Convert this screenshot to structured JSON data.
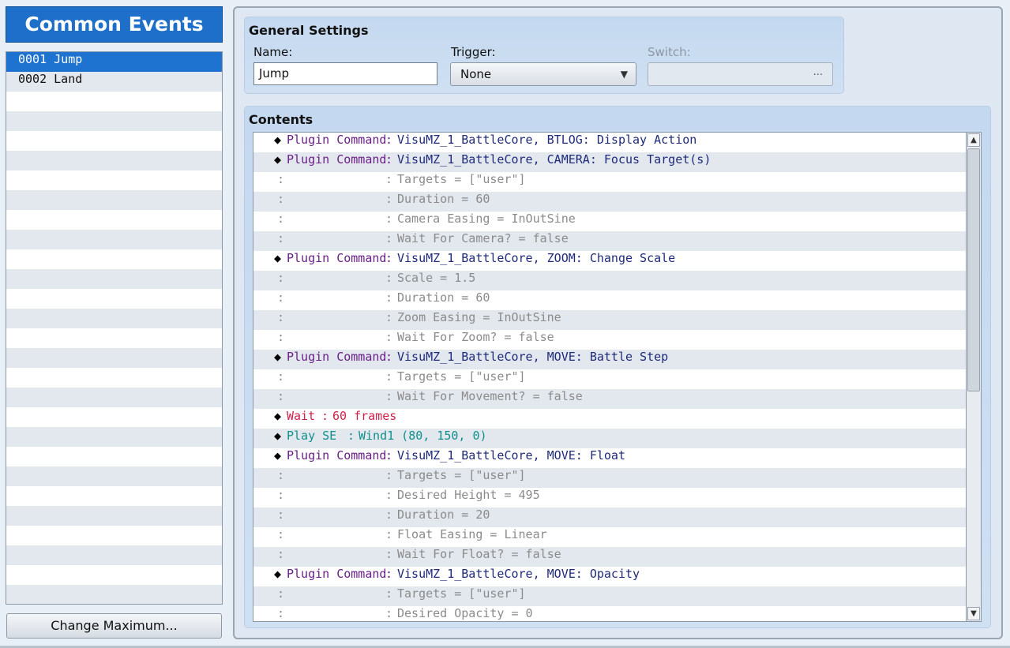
{
  "sidebar": {
    "title": "Common Events",
    "items": [
      {
        "id": "0001",
        "label": "Jump"
      },
      {
        "id": "0002",
        "label": "Land"
      }
    ],
    "change_max_label": "Change Maximum..."
  },
  "general": {
    "title": "General Settings",
    "name_label": "Name:",
    "name_value": "Jump",
    "trigger_label": "Trigger:",
    "trigger_value": "None",
    "switch_label": "Switch:",
    "switch_value": "",
    "switch_button": "..."
  },
  "contents": {
    "title": "Contents",
    "commands": [
      {
        "type": "plugin",
        "name": "Plugin Command",
        "text": "VisuMZ_1_BattleCore, BTLOG: Display Action"
      },
      {
        "type": "plugin",
        "name": "Plugin Command",
        "text": "VisuMZ_1_BattleCore, CAMERA: Focus Target(s)"
      },
      {
        "type": "cont",
        "text": "Targets = [\"user\"]"
      },
      {
        "type": "cont",
        "text": "Duration = 60"
      },
      {
        "type": "cont",
        "text": "Camera Easing = InOutSine"
      },
      {
        "type": "cont",
        "text": "Wait For Camera? = false"
      },
      {
        "type": "plugin",
        "name": "Plugin Command",
        "text": "VisuMZ_1_BattleCore, ZOOM: Change Scale"
      },
      {
        "type": "cont",
        "text": "Scale = 1.5"
      },
      {
        "type": "cont",
        "text": "Duration = 60"
      },
      {
        "type": "cont",
        "text": "Zoom Easing = InOutSine"
      },
      {
        "type": "cont",
        "text": "Wait For Zoom? = false"
      },
      {
        "type": "plugin",
        "name": "Plugin Command",
        "text": "VisuMZ_1_BattleCore, MOVE: Battle Step"
      },
      {
        "type": "cont",
        "text": "Targets = [\"user\"]"
      },
      {
        "type": "cont",
        "text": "Wait For Movement? = false"
      },
      {
        "type": "wait",
        "name": "Wait",
        "text": "60 frames"
      },
      {
        "type": "se",
        "name": "Play SE",
        "text": "Wind1 (80, 150, 0)"
      },
      {
        "type": "plugin",
        "name": "Plugin Command",
        "text": "VisuMZ_1_BattleCore, MOVE: Float"
      },
      {
        "type": "cont",
        "text": "Targets = [\"user\"]"
      },
      {
        "type": "cont",
        "text": "Desired Height = 495"
      },
      {
        "type": "cont",
        "text": "Duration = 20"
      },
      {
        "type": "cont",
        "text": "Float Easing = Linear"
      },
      {
        "type": "cont",
        "text": "Wait For Float? = false"
      },
      {
        "type": "plugin",
        "name": "Plugin Command",
        "text": "VisuMZ_1_BattleCore, MOVE: Opacity"
      },
      {
        "type": "cont",
        "text": "Targets = [\"user\"]"
      },
      {
        "type": "cont",
        "text": "Desired Opacity = 0"
      }
    ]
  },
  "scrollbar": {
    "up_glyph": "▲",
    "down_glyph": "▼"
  },
  "colors": {
    "title_bar": "#1d6fc9",
    "selection": "#1e73d1",
    "plugin_name": "#6a1f88",
    "plugin_text": "#1e2a7a",
    "continuation": "#8b8b8b",
    "wait": "#d0204a",
    "se": "#10908a"
  }
}
